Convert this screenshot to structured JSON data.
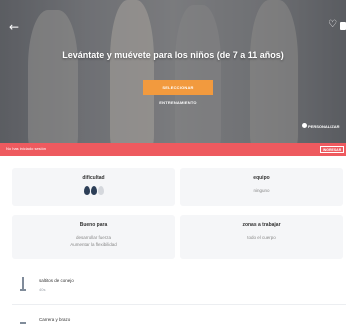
{
  "hero": {
    "title": "Levántate y muévete para los niños (de 7 a 11 años)",
    "cta_label": "SELECCIONAR ENTRENAMIENTO",
    "personalize_label": "PERSONALIZAR"
  },
  "banner": {
    "text": "No has iniciado sesión",
    "login_label": "INGRESAR"
  },
  "cards": {
    "difficulty": {
      "title": "dificultad",
      "level": 2,
      "max": 3
    },
    "equipment": {
      "title": "equipo",
      "value": "ninguno"
    },
    "good_for": {
      "title": "Bueno para",
      "items": [
        "desarrollar fuerza",
        "Aumentar la flexibilidad"
      ]
    },
    "zones": {
      "title": "zonas a trabajar",
      "value": "todo el cuerpo"
    }
  },
  "exercises": [
    {
      "name": "saltitos de conejo",
      "sub": "40s"
    },
    {
      "name": "Carrera y brazo",
      "sub": ""
    }
  ],
  "colors": {
    "accent": "#f29a3e",
    "banner": "#ee5a5f",
    "drop_on": "#2c3e57",
    "drop_off": "#d5d8dd"
  }
}
